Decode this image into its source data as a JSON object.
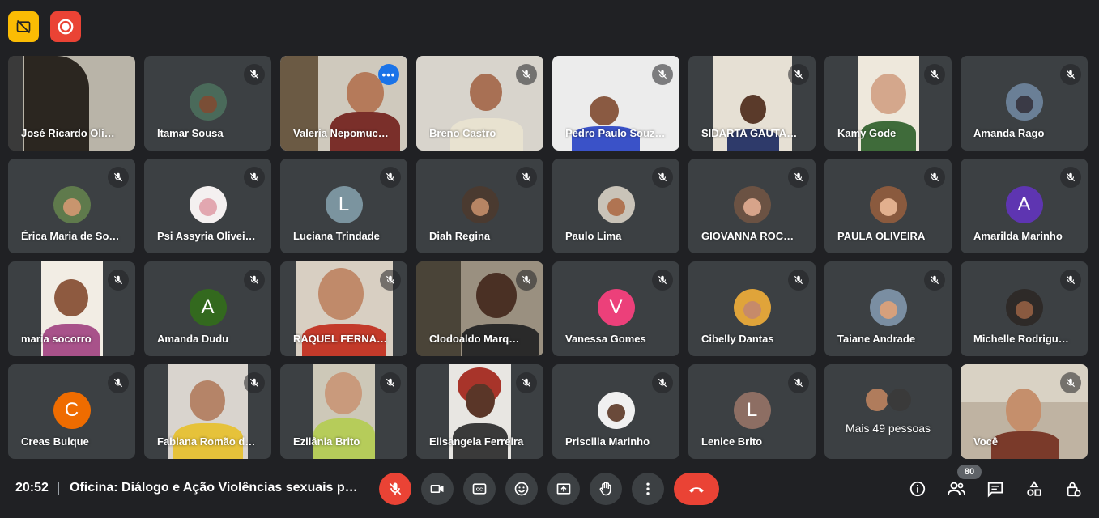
{
  "top_badges": [
    {
      "icon": "captions-off-icon",
      "color": "#fbbc04"
    },
    {
      "icon": "recording-icon",
      "color": "#ea4335"
    }
  ],
  "participants": [
    {
      "name": "José Ricardo Oli…",
      "kind": "video"
    },
    {
      "name": "Itamar Sousa",
      "kind": "photo"
    },
    {
      "name": "Valeria Nepomuc…",
      "kind": "video",
      "active": true
    },
    {
      "name": "Breno Castro",
      "kind": "video"
    },
    {
      "name": "Pedro Paulo Souz…",
      "kind": "video"
    },
    {
      "name": "SIDARTA GAUTA…",
      "kind": "video"
    },
    {
      "name": "Kamy Gode",
      "kind": "video"
    },
    {
      "name": "Amanda Rago",
      "kind": "photo"
    },
    {
      "name": "Érica Maria de So…",
      "kind": "photo"
    },
    {
      "name": "Psi Assyria Olivei…",
      "kind": "photo"
    },
    {
      "name": "Luciana Trindade",
      "kind": "letter",
      "letter": "L",
      "color": "#7b949f"
    },
    {
      "name": "Diah Regina",
      "kind": "photo"
    },
    {
      "name": "Paulo Lima",
      "kind": "photo"
    },
    {
      "name": "GIOVANNA ROC…",
      "kind": "photo"
    },
    {
      "name": "PAULA OLIVEIRA",
      "kind": "photo"
    },
    {
      "name": "Amarilda Marinho",
      "kind": "letter",
      "letter": "A",
      "color": "#5e35b1"
    },
    {
      "name": "maria socorro",
      "kind": "video"
    },
    {
      "name": "Amanda Dudu",
      "kind": "letter",
      "letter": "A",
      "color": "#33691e"
    },
    {
      "name": "RAQUEL FERNA…",
      "kind": "video"
    },
    {
      "name": "Clodoaldo Marq…",
      "kind": "video"
    },
    {
      "name": "Vanessa Gomes",
      "kind": "letter",
      "letter": "V",
      "color": "#ec407a"
    },
    {
      "name": "Cibelly Dantas",
      "kind": "photo"
    },
    {
      "name": "Taiane Andrade",
      "kind": "photo"
    },
    {
      "name": "Michelle Rodrigu…",
      "kind": "photo"
    },
    {
      "name": "Creas Buique",
      "kind": "letter",
      "letter": "C",
      "color": "#ef6c00"
    },
    {
      "name": "Fabiana Romão d…",
      "kind": "video"
    },
    {
      "name": "Ezilânia Brito",
      "kind": "video"
    },
    {
      "name": "Elisangela Ferreira",
      "kind": "video"
    },
    {
      "name": "Priscilla Marinho",
      "kind": "photo"
    },
    {
      "name": "Lenice Brito",
      "kind": "letter",
      "letter": "L",
      "color": "#8d6e63"
    },
    {
      "name": "Mais 49 pessoas",
      "kind": "more"
    },
    {
      "name": "Você",
      "kind": "video"
    }
  ],
  "bottom": {
    "time": "20:52",
    "meeting_title": "Oficina: Diálogo e Ação Violências sexuais pra…",
    "participant_count": "80"
  },
  "controls": [
    "mic-off-icon",
    "camera-icon",
    "captions-icon",
    "emoji-icon",
    "present-icon",
    "raise-hand-icon",
    "more-options-icon",
    "hang-up-icon"
  ],
  "right_icons": [
    "info-icon",
    "people-icon",
    "chat-icon",
    "activities-icon",
    "host-controls-icon"
  ]
}
